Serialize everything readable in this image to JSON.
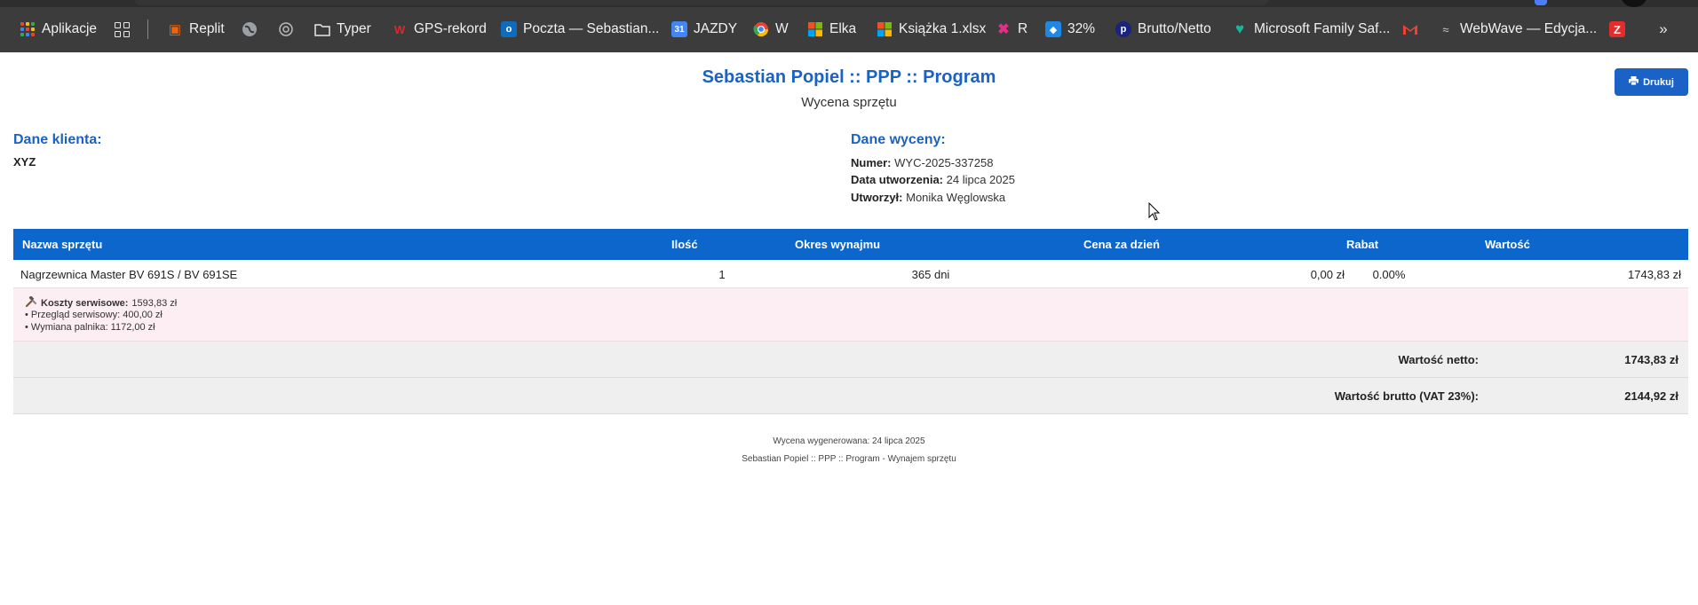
{
  "bookmarks": [
    {
      "label": "Aplikacje",
      "icon": "apps-grid-icon"
    },
    {
      "label": "",
      "icon": "tab-groups-icon"
    },
    {
      "label": "Replit",
      "icon": "replit-icon"
    },
    {
      "label": "",
      "icon": "globe-icon"
    },
    {
      "label": "",
      "icon": "openai-icon"
    },
    {
      "label": "Typer",
      "icon": "folder-icon"
    },
    {
      "label": "GPS-rekord",
      "icon": "wp-icon"
    },
    {
      "label": "Poczta — Sebastian...",
      "icon": "outlook-icon"
    },
    {
      "label": "JAZDY",
      "icon": "calendar-icon"
    },
    {
      "label": "W",
      "icon": "chrome-icon"
    },
    {
      "label": "Elka",
      "icon": "microsoft-icon"
    },
    {
      "label": "Książka 1.xlsx",
      "icon": "microsoft-icon"
    },
    {
      "label": "R",
      "icon": "r-icon"
    },
    {
      "label": "32%",
      "icon": "bulb-icon"
    },
    {
      "label": "Brutto/Netto",
      "icon": "p-icon"
    },
    {
      "label": "Microsoft Family Saf...",
      "icon": "family-icon"
    },
    {
      "label": "",
      "icon": "gmail-icon"
    },
    {
      "label": "WebWave — Edycja...",
      "icon": "webwave-icon"
    },
    {
      "label": "",
      "icon": "z-icon"
    }
  ],
  "header": {
    "title": "Sebastian Popiel :: PPP :: Program",
    "subtitle": "Wycena sprzętu",
    "print_label": "Drukuj"
  },
  "client": {
    "heading": "Dane klienta:",
    "name": "XYZ"
  },
  "quote": {
    "heading": "Dane wyceny:",
    "number_label": "Numer:",
    "number": "WYC-2025-337258",
    "created_label": "Data utworzenia:",
    "created": "24 lipca 2025",
    "author_label": "Utworzył:",
    "author": "Monika Węglowska"
  },
  "table": {
    "columns": [
      "Nazwa sprzętu",
      "Ilość",
      "Okres wynajmu",
      "Cena za dzień",
      "Rabat",
      "Wartość"
    ],
    "rows": [
      {
        "name": "Nagrzewnica Master BV 691S / BV 691SE",
        "qty": "1",
        "period": "365 dni",
        "price": "0,00 zł",
        "discount": "0.00%",
        "value": "1743,83 zł"
      }
    ],
    "service": {
      "label": "Koszty serwisowe:",
      "total": "1593,83 zł",
      "items": [
        "• Przegląd serwisowy: 400,00 zł",
        "• Wymiana palnika: 1172,00 zł"
      ]
    },
    "net_label": "Wartość netto:",
    "net_value": "1743,83 zł",
    "gross_label": "Wartość brutto (VAT 23%):",
    "gross_value": "2144,92 zł"
  },
  "footer": {
    "generated": "Wycena wygenerowana: 24 lipca 2025",
    "brand": "Sebastian Popiel :: PPP :: Program - Wynajem sprzętu"
  },
  "colors": {
    "accent": "#1a62c6",
    "table_header": "#0d66cc",
    "service_bg": "#fdeef3",
    "summary_bg": "#efefef",
    "bookmarks_bg": "#3c3c3c"
  }
}
